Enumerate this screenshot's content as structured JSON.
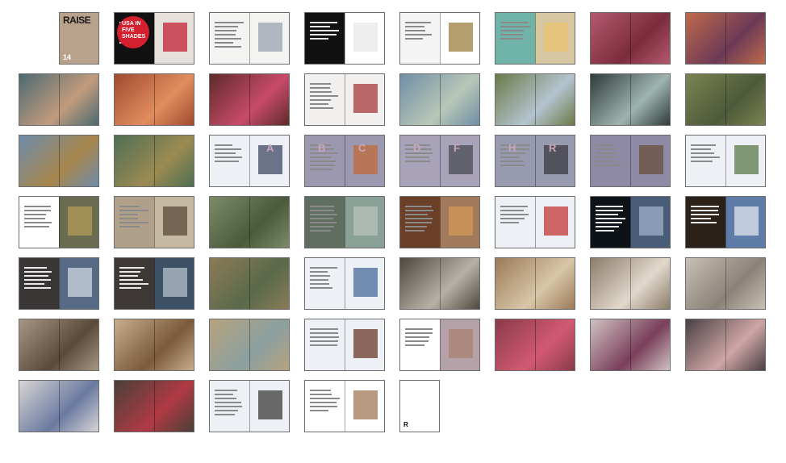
{
  "page": {
    "background": "#ffffff",
    "border_color": "#6c6c6c"
  },
  "cover": {
    "masthead": "RAISE",
    "issue": "14"
  },
  "spread_2": {
    "badge_text": "USA IN FIVE SHADES"
  },
  "spread_19_letters": [
    "A"
  ],
  "spread_20_letters": [
    "B",
    "C"
  ],
  "spread_21_letters": [
    "D",
    "F"
  ],
  "spread_22_letters": [
    "H",
    "R"
  ],
  "last_page_mark": "R",
  "thumbnails": [
    {
      "label": "cover",
      "layout": "single",
      "bg": "#b9a28c",
      "accent": "#3b4f7a"
    },
    {
      "label": "spread-2",
      "layout": "spread",
      "left": "#111111",
      "right": "#e6e0dc",
      "accent": "#c22234"
    },
    {
      "label": "spread-3",
      "layout": "spread",
      "left": "#f3f3f1",
      "right": "#f3f3f1",
      "accent": "#9aa3b0"
    },
    {
      "label": "spread-4",
      "layout": "spread",
      "left": "#111111",
      "right": "#ffffff",
      "accent": "#e8e8e8"
    },
    {
      "label": "spread-5",
      "layout": "spread",
      "left": "#f4f4f4",
      "right": "#ffffff",
      "accent": "#9c7d3c"
    },
    {
      "label": "spread-6",
      "layout": "spread",
      "left": "#6fb3a9",
      "right": "#d7c6a2",
      "accent": "#e9c36d"
    },
    {
      "label": "spread-7",
      "layout": "full",
      "bg": "#b55970",
      "accent": "#7b2c3c"
    },
    {
      "label": "spread-8",
      "layout": "full",
      "bg": "#bf6a4c",
      "accent": "#6c3a56"
    },
    {
      "label": "spread-9",
      "layout": "full",
      "bg": "#4c6a72",
      "accent": "#c29b7d"
    },
    {
      "label": "spread-10",
      "layout": "full",
      "bg": "#a04a30",
      "accent": "#e08d5e"
    },
    {
      "label": "spread-11",
      "layout": "full",
      "bg": "#5e2a2a",
      "accent": "#c84b6a"
    },
    {
      "label": "spread-12",
      "layout": "spread",
      "left": "#f2f0ef",
      "right": "#f2f0ef",
      "accent": "#a53a3c"
    },
    {
      "label": "spread-13",
      "layout": "full",
      "bg": "#6f8fa5",
      "accent": "#b8c7b8"
    },
    {
      "label": "spread-14",
      "layout": "full",
      "bg": "#6a7a48",
      "accent": "#b4c4d0"
    },
    {
      "label": "spread-15",
      "layout": "full",
      "bg": "#2f3c3c",
      "accent": "#9eb4b0"
    },
    {
      "label": "spread-16",
      "layout": "full",
      "bg": "#7a8452",
      "accent": "#4e5a3a"
    },
    {
      "label": "spread-17",
      "layout": "full",
      "bg": "#6d8cab",
      "accent": "#a8864c"
    },
    {
      "label": "spread-18",
      "layout": "full",
      "bg": "#4f6e52",
      "accent": "#9b8b52"
    },
    {
      "label": "spread-19",
      "layout": "spread",
      "left": "#edf0f4",
      "right": "#edf0f4",
      "accent": "#3d4a64"
    },
    {
      "label": "spread-20",
      "layout": "spread",
      "left": "#9c98b0",
      "right": "#9c98b0",
      "accent": "#c26b3c"
    },
    {
      "label": "spread-21",
      "layout": "spread",
      "left": "#a8a3b8",
      "right": "#a8a3b8",
      "accent": "#4b4b55"
    },
    {
      "label": "spread-22",
      "layout": "spread",
      "left": "#989bb0",
      "right": "#989bb0",
      "accent": "#3a3a40"
    },
    {
      "label": "spread-23",
      "layout": "spread",
      "left": "#8e8aa6",
      "right": "#8e8aa6",
      "accent": "#6a4f3a"
    },
    {
      "label": "spread-24",
      "layout": "spread",
      "left": "#edf0f4",
      "right": "#edf0f4",
      "accent": "#5b7a4c"
    },
    {
      "label": "spread-25",
      "layout": "spread",
      "left": "#ffffff",
      "right": "#6b6b52",
      "accent": "#b49a5a"
    },
    {
      "label": "spread-26",
      "layout": "spread",
      "left": "#b0a08a",
      "right": "#c6b9a2",
      "accent": "#5b4a38"
    },
    {
      "label": "spread-27",
      "layout": "full",
      "bg": "#7c8b6a",
      "accent": "#4a5a3a"
    },
    {
      "label": "spread-28",
      "layout": "spread",
      "left": "#5f6e60",
      "right": "#88a096",
      "accent": "#b8c0bb"
    },
    {
      "label": "spread-29",
      "layout": "spread",
      "left": "#6b3f28",
      "right": "#a07a5a",
      "accent": "#d39a5a"
    },
    {
      "label": "spread-30",
      "layout": "spread",
      "left": "#edf0f4",
      "right": "#edf0f4",
      "accent": "#c33838"
    },
    {
      "label": "spread-31",
      "layout": "spread",
      "left": "#0d1118",
      "right": "#4a5d78",
      "accent": "#9fb0c8"
    },
    {
      "label": "spread-32",
      "layout": "spread",
      "left": "#2b2118",
      "right": "#5f7ca8",
      "accent": "#dfe6ef"
    },
    {
      "label": "spread-33",
      "layout": "spread",
      "left": "#3b3636",
      "right": "#566a86",
      "accent": "#cfd8e2"
    },
    {
      "label": "spread-34",
      "layout": "spread",
      "left": "#3e3937",
      "right": "#3c5066",
      "accent": "#b5c2cd"
    },
    {
      "label": "spread-35",
      "layout": "full",
      "bg": "#8b7b58",
      "accent": "#5a6a4a"
    },
    {
      "label": "spread-36",
      "layout": "spread",
      "left": "#edf0f4",
      "right": "#edf0f4",
      "accent": "#486a9a"
    },
    {
      "label": "spread-37",
      "layout": "full",
      "bg": "#4e4840",
      "accent": "#b7b0a6"
    },
    {
      "label": "spread-38",
      "layout": "full",
      "bg": "#9b7a58",
      "accent": "#d8c6a8"
    },
    {
      "label": "spread-39",
      "layout": "full",
      "bg": "#8c7d6a",
      "accent": "#e1d8cc"
    },
    {
      "label": "spread-40",
      "layout": "full",
      "bg": "#c8c0b4",
      "accent": "#8a8278"
    },
    {
      "label": "spread-41",
      "layout": "full",
      "bg": "#a89684",
      "accent": "#5a4a3a"
    },
    {
      "label": "spread-42",
      "layout": "full",
      "bg": "#c7ae8e",
      "accent": "#7a5a3a"
    },
    {
      "label": "spread-43",
      "layout": "full",
      "bg": "#b7a27e",
      "accent": "#8ca0a0"
    },
    {
      "label": "spread-44",
      "layout": "spread",
      "left": "#edf0f4",
      "right": "#edf0f4",
      "accent": "#6a3a2a"
    },
    {
      "label": "spread-45",
      "layout": "spread",
      "left": "#ffffff",
      "right": "#b4a2a8",
      "accent": "#a88070"
    },
    {
      "label": "spread-46",
      "layout": "full",
      "bg": "#8a3a4a",
      "accent": "#d25a72"
    },
    {
      "label": "spread-47",
      "layout": "full",
      "bg": "#cfc2c2",
      "accent": "#7a3e5a"
    },
    {
      "label": "spread-48",
      "layout": "full",
      "bg": "#4a4045",
      "accent": "#cfa6a6"
    },
    {
      "label": "spread-49",
      "layout": "full",
      "bg": "#d8d4d6",
      "accent": "#6a7aa0"
    },
    {
      "label": "spread-50",
      "layout": "full",
      "bg": "#4a4038",
      "accent": "#b03a44"
    },
    {
      "label": "spread-51",
      "layout": "spread",
      "left": "#edf0f4",
      "right": "#edf0f4",
      "accent": "#3b3b3b"
    },
    {
      "label": "spread-52",
      "layout": "spread",
      "left": "#ffffff",
      "right": "#ffffff",
      "accent": "#a0785a"
    },
    {
      "label": "back-page",
      "layout": "single",
      "bg": "#ffffff",
      "accent": "#ffffff"
    }
  ]
}
